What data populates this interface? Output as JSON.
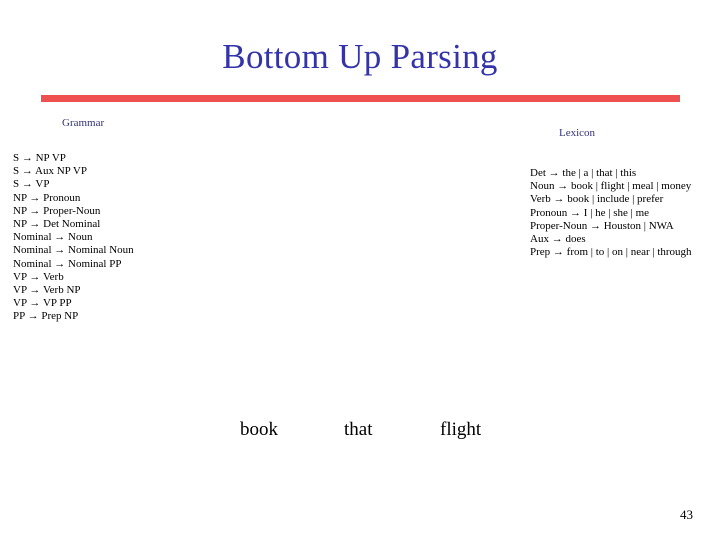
{
  "slide": {
    "title": "Bottom Up Parsing",
    "title_color": "#3333AA",
    "divider_color": "#EE5050",
    "page_number": "43"
  },
  "grammar": {
    "heading": "Grammar",
    "heading_color": "#333377",
    "rules": [
      "S → NP VP",
      "S → Aux NP VP",
      "S → VP",
      "NP → Pronoun",
      "NP → Proper-Noun",
      "NP → Det Nominal",
      "Nominal → Noun",
      "Nominal → Nominal Noun",
      "Nominal → Nominal PP",
      "VP → Verb",
      "VP → Verb NP",
      "VP → VP PP",
      "PP → Prep NP"
    ]
  },
  "lexicon": {
    "heading": "Lexicon",
    "heading_color": "#333377",
    "rules": [
      "Det → the | a | that | this",
      "Noun → book | flight | meal | money",
      "Verb → book | include | prefer",
      "Pronoun → I | he | she | me",
      "Proper-Noun → Houston | NWA",
      "Aux → does",
      "Prep → from | to | on | near | through"
    ]
  },
  "sentence": {
    "words": [
      "book",
      "that",
      "flight"
    ]
  }
}
